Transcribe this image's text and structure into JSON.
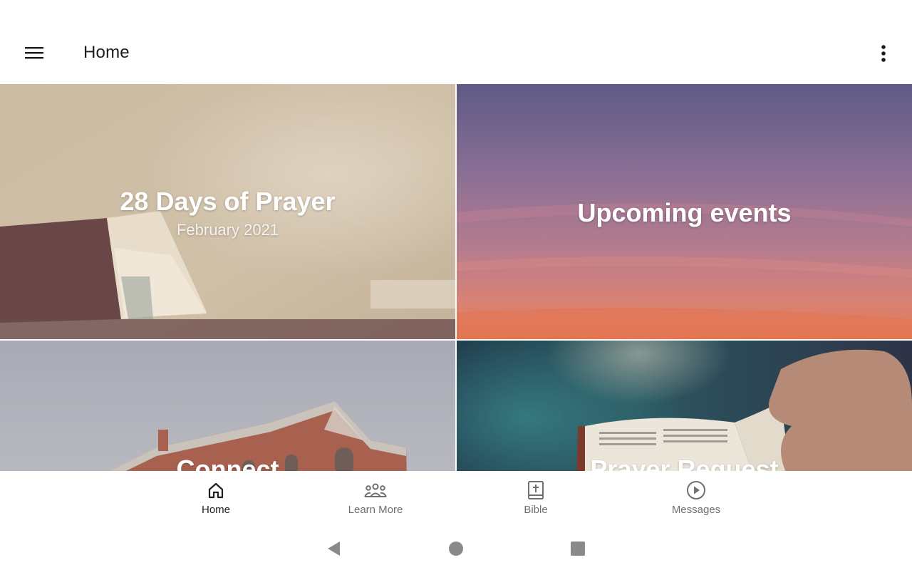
{
  "appbar": {
    "title": "Home",
    "menu_icon": "hamburger-menu-icon",
    "overflow_icon": "more-vertical-icon"
  },
  "tiles": [
    {
      "title": "28 Days of Prayer",
      "subtitle": "February 2021"
    },
    {
      "title": "Upcoming events"
    },
    {
      "title": "Connect"
    },
    {
      "title": "Prayer Request"
    }
  ],
  "bottom_nav": {
    "items": [
      {
        "label": "Home",
        "icon": "home-icon",
        "active": true
      },
      {
        "label": "Learn More",
        "icon": "people-group-icon",
        "active": false
      },
      {
        "label": "Bible",
        "icon": "bible-icon",
        "active": false
      },
      {
        "label": "Messages",
        "icon": "play-circle-icon",
        "active": false
      }
    ]
  },
  "system_nav": {
    "back_icon": "back-triangle-icon",
    "home_icon": "home-circle-icon",
    "recents_icon": "recents-square-icon"
  },
  "colors": {
    "active_text": "#1f1f1f",
    "inactive_text": "#6f6f6f",
    "icon_gray": "#6f6f6f",
    "system_nav_gray": "#8a8a8a"
  }
}
